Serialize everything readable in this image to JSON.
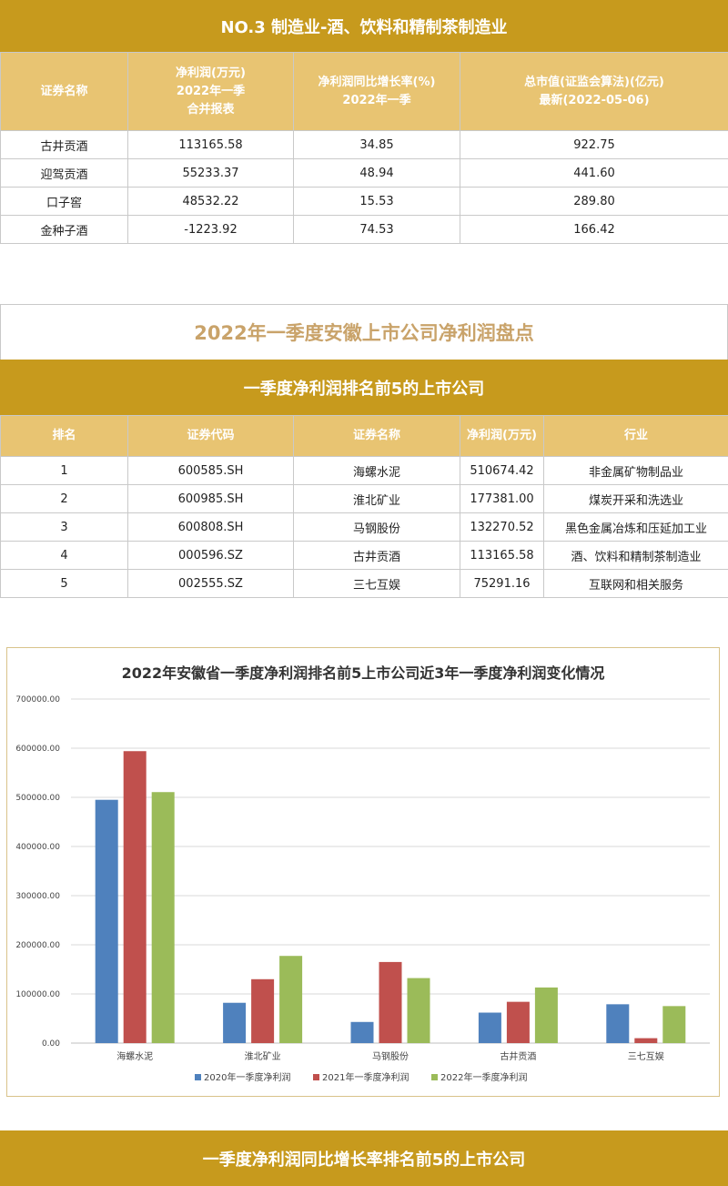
{
  "section1": {
    "banner": "NO.3 制造业-酒、饮料和精制茶制造业",
    "headers": [
      [
        "证券名称"
      ],
      [
        "净利润(万元)",
        "2022年一季",
        "合并报表"
      ],
      [
        "净利润同比增长率(%)",
        "2022年一季"
      ],
      [
        "总市值(证监会算法)(亿元)",
        "最新(2022-05-06)"
      ]
    ],
    "rows": [
      [
        "古井贡酒",
        "113165.58",
        "34.85",
        "922.75"
      ],
      [
        "迎驾贡酒",
        "55233.37",
        "48.94",
        "441.60"
      ],
      [
        "口子窖",
        "48532.22",
        "15.53",
        "289.80"
      ],
      [
        "金种子酒",
        "-1223.92",
        "74.53",
        "166.42"
      ]
    ]
  },
  "report_title": "2022年一季度安徽上市公司净利润盘点",
  "section2": {
    "banner": "一季度净利润排名前5的上市公司",
    "headers": [
      "排名",
      "证券代码",
      "证券名称",
      "净利润(万元)",
      "行业"
    ],
    "rows": [
      [
        "1",
        "600585.SH",
        "海螺水泥",
        "510674.42",
        "非金属矿物制品业"
      ],
      [
        "2",
        "600985.SH",
        "淮北矿业",
        "177381.00",
        "煤炭开采和洗选业"
      ],
      [
        "3",
        "600808.SH",
        "马钢股份",
        "132270.52",
        "黑色金属冶炼和压延加工业"
      ],
      [
        "4",
        "000596.SZ",
        "古井贡酒",
        "113165.58",
        "酒、饮料和精制茶制造业"
      ],
      [
        "5",
        "002555.SZ",
        "三七互娱",
        "75291.16",
        "互联网和相关服务"
      ]
    ]
  },
  "chart_data": {
    "type": "bar",
    "title": "2022年安徽省一季度净利润排名前5上市公司近3年一季度净利润变化情况",
    "categories": [
      "海螺水泥",
      "淮北矿业",
      "马钢股份",
      "古井贡酒",
      "三七互娱"
    ],
    "series": [
      {
        "name": "2020年一季度净利润",
        "color": "#4f81bd",
        "values": [
          495000,
          82000,
          43000,
          62000,
          79000
        ]
      },
      {
        "name": "2021年一季度净利润",
        "color": "#c0504d",
        "values": [
          594000,
          130000,
          165000,
          84000,
          10000
        ]
      },
      {
        "name": "2022年一季度净利润",
        "color": "#9bbb59",
        "values": [
          510674.42,
          177381.0,
          132270.52,
          113165.58,
          75291.16
        ]
      }
    ],
    "yticks": [
      "0.00",
      "100000.00",
      "200000.00",
      "300000.00",
      "400000.00",
      "500000.00",
      "600000.00",
      "700000.00"
    ],
    "ylim": [
      0,
      700000
    ],
    "grid": true,
    "legend_position": "bottom"
  },
  "section3": {
    "banner": "一季度净利润同比增长率排名前5的上市公司"
  }
}
